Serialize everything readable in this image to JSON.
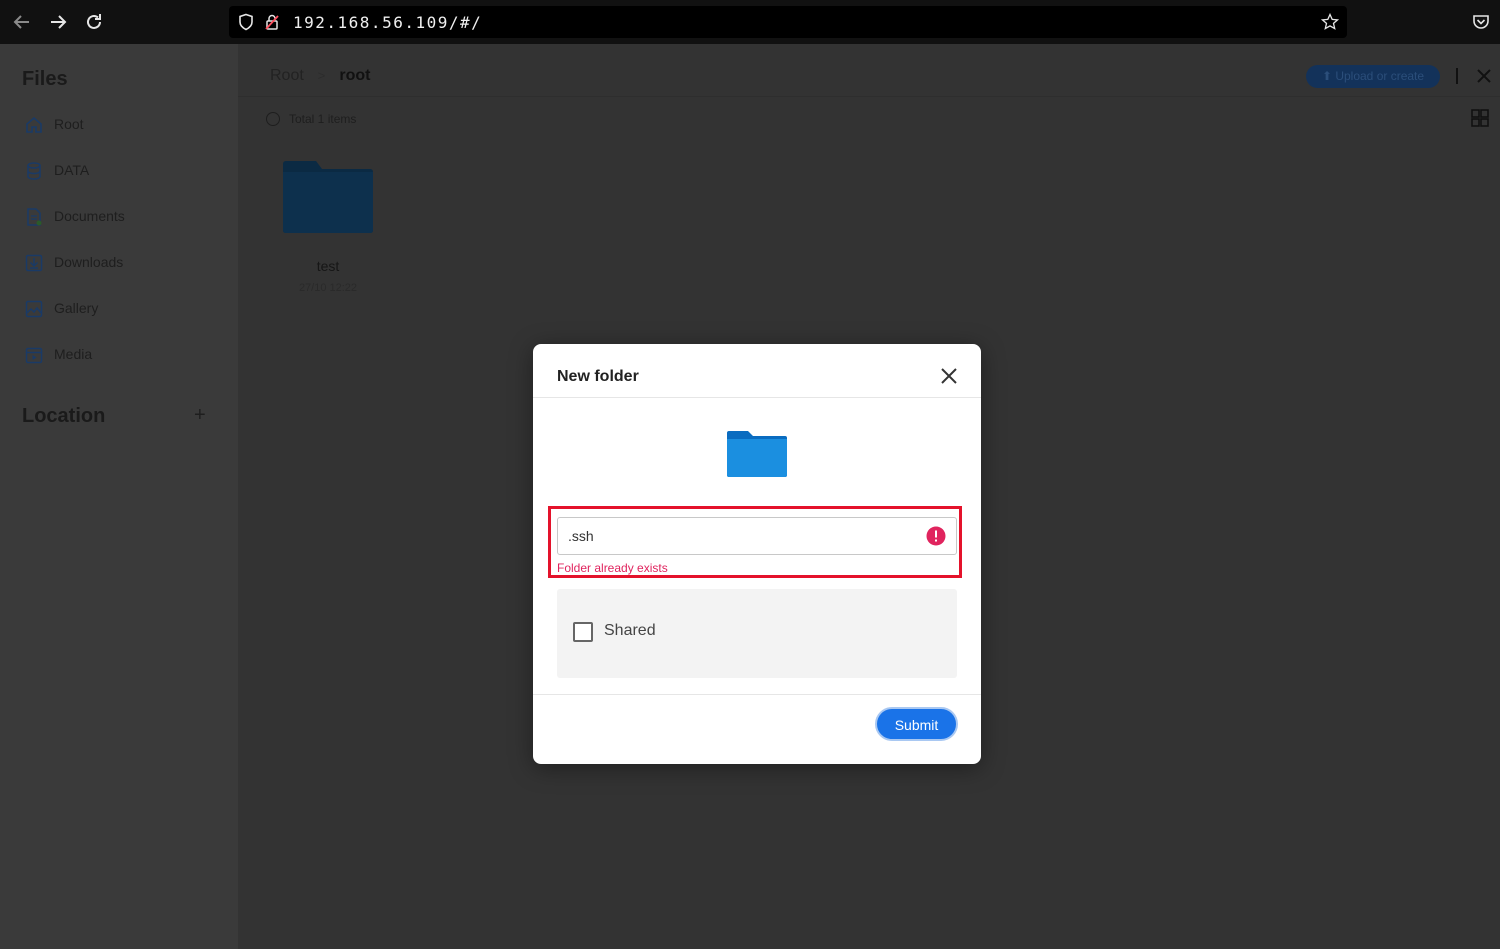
{
  "browser": {
    "url": "192.168.56.109/#/"
  },
  "sidebar": {
    "title": "Files",
    "items": [
      {
        "label": "Root",
        "icon": "home-icon"
      },
      {
        "label": "DATA",
        "icon": "database-icon"
      },
      {
        "label": "Documents",
        "icon": "document-icon"
      },
      {
        "label": "Downloads",
        "icon": "download-icon"
      },
      {
        "label": "Gallery",
        "icon": "image-icon"
      },
      {
        "label": "Media",
        "icon": "media-icon"
      }
    ],
    "location_title": "Location",
    "location_add": "+"
  },
  "header": {
    "breadcrumb": [
      "Root",
      "root"
    ],
    "breadcrumb_separator": ">",
    "upload_label": "Upload or create"
  },
  "content": {
    "total_label": "Total 1 items",
    "items": [
      {
        "name": "test",
        "date": "27/10 12:22"
      }
    ]
  },
  "modal": {
    "title": "New folder",
    "input_value": ".ssh",
    "error_message": "Folder already exists",
    "shared_label": "Shared",
    "shared_checked": false,
    "submit_label": "Submit"
  },
  "colors": {
    "accent": "#1a73e8",
    "error": "#e0245e",
    "highlight_frame": "#e4122b",
    "folder": "#1b8fe0"
  }
}
